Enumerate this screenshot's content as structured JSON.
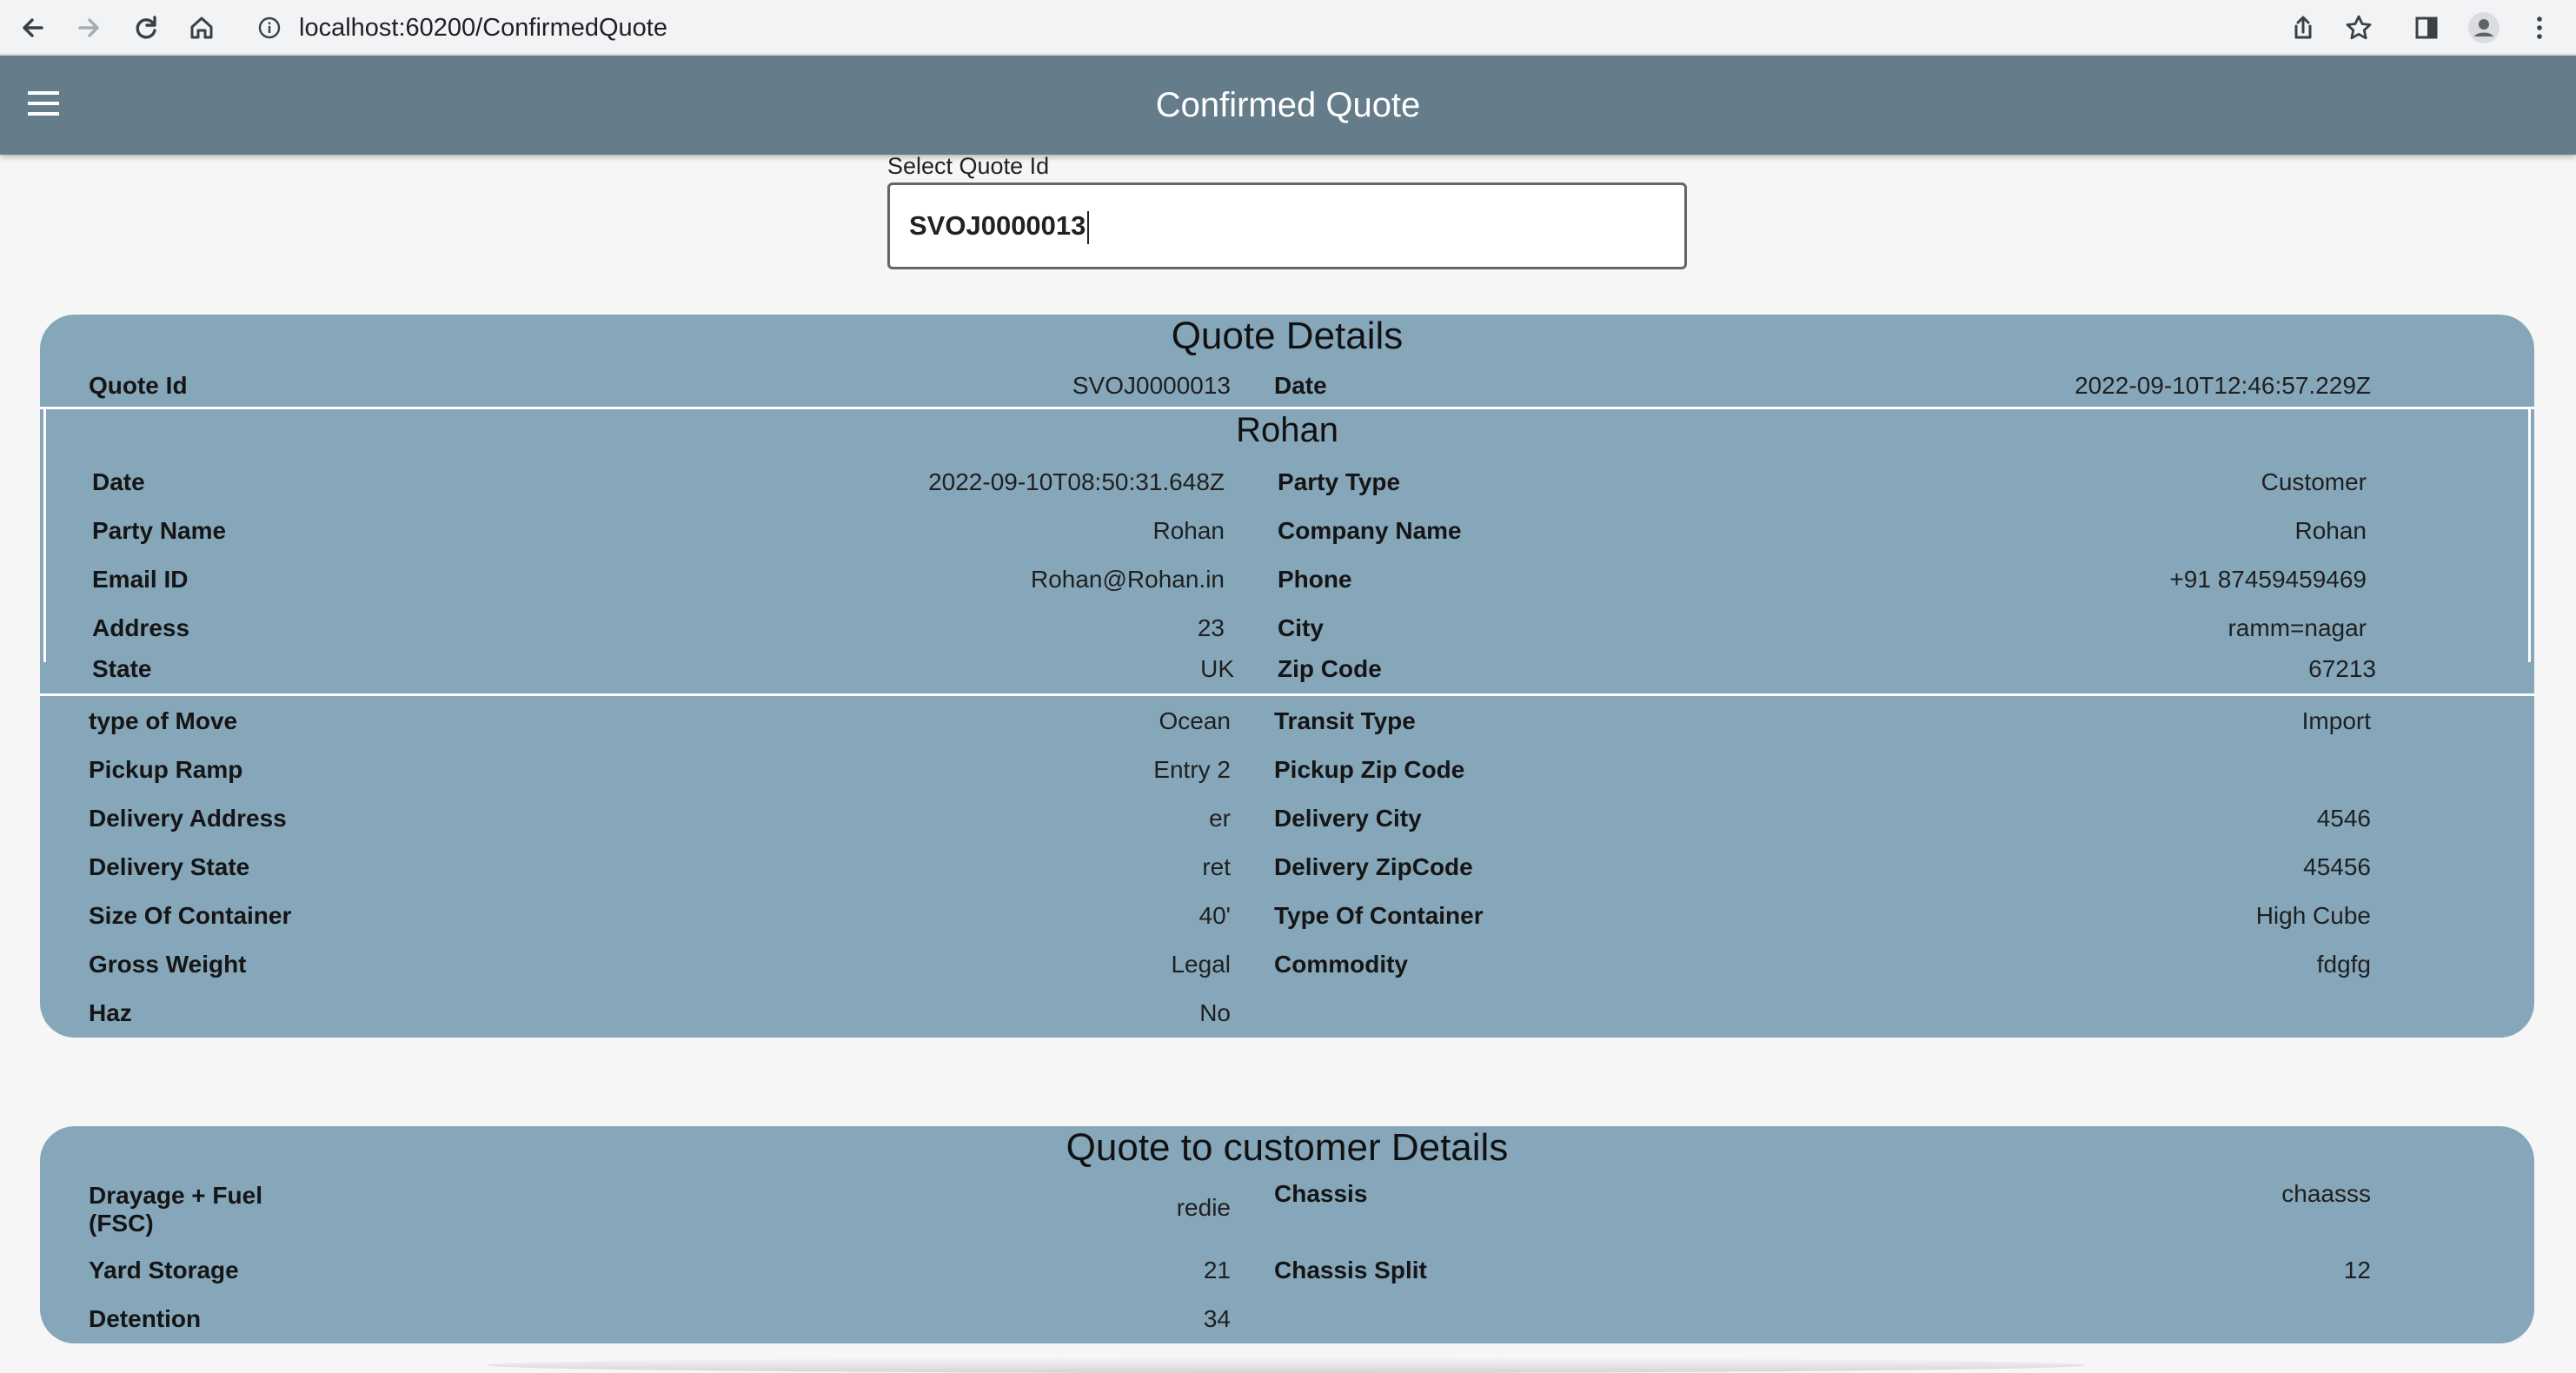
{
  "browser": {
    "url": "localhost:60200/ConfirmedQuote",
    "icons": [
      "back-icon",
      "forward-icon",
      "reload-icon",
      "home-icon",
      "info-icon",
      "share-icon",
      "star-icon",
      "side-panel-icon",
      "profile-icon",
      "kebab-icon"
    ]
  },
  "appbar": {
    "title": "Confirmed Quote",
    "menu_icon": "menu-icon"
  },
  "selector": {
    "label": "Select Quote Id",
    "value": "SVOJ0000013"
  },
  "quote_details": {
    "title": "Quote Details",
    "header_row": [
      {
        "label": "Quote Id",
        "value": "SVOJ0000013"
      },
      {
        "label": "Date",
        "value": "2022-09-10T12:46:57.229Z"
      }
    ],
    "party": {
      "title": "Rohan",
      "rows": [
        [
          {
            "label": "Date",
            "value": "2022-09-10T08:50:31.648Z"
          },
          {
            "label": "Party Type",
            "value": "Customer"
          }
        ],
        [
          {
            "label": "Party Name",
            "value": "Rohan"
          },
          {
            "label": "Company Name",
            "value": "Rohan"
          }
        ],
        [
          {
            "label": "Email ID",
            "value": "Rohan@Rohan.in"
          },
          {
            "label": "Phone",
            "value": "+91 87459459469"
          }
        ],
        [
          {
            "label": "Address",
            "value": "23"
          },
          {
            "label": "City",
            "value": "ramm=nagar"
          }
        ],
        [
          {
            "label": "State",
            "value": "UK"
          },
          {
            "label": "Zip Code",
            "value": "67213"
          }
        ]
      ]
    },
    "move_rows": [
      [
        {
          "label": "type of Move",
          "value": "Ocean"
        },
        {
          "label": "Transit Type",
          "value": "Import"
        }
      ],
      [
        {
          "label": "Pickup Ramp",
          "value": "Entry 2"
        },
        {
          "label": "Pickup Zip Code",
          "value": ""
        }
      ],
      [
        {
          "label": "Delivery Address",
          "value": "er"
        },
        {
          "label": "Delivery City",
          "value": "4546"
        }
      ],
      [
        {
          "label": "Delivery State",
          "value": "ret"
        },
        {
          "label": "Delivery ZipCode",
          "value": "45456"
        }
      ],
      [
        {
          "label": "Size Of Container",
          "value": "40'"
        },
        {
          "label": "Type Of Container",
          "value": "High Cube"
        }
      ],
      [
        {
          "label": "Gross Weight",
          "value": "Legal"
        },
        {
          "label": "Commodity",
          "value": "fdgfg"
        }
      ],
      [
        {
          "label": "Haz",
          "value": "No"
        },
        null
      ]
    ]
  },
  "customer_details": {
    "title": "Quote to customer Details",
    "rows": [
      [
        {
          "label_line1": "Drayage + Fuel",
          "label_line2": "(FSC)",
          "value": "redie"
        },
        {
          "label": "Chassis",
          "value": "chaasss"
        }
      ],
      [
        {
          "label": "Yard  Storage",
          "value": "21"
        },
        {
          "label": "Chassis  Split",
          "value": "12"
        }
      ],
      [
        {
          "label": "Detention",
          "value": "34"
        },
        null
      ]
    ]
  }
}
